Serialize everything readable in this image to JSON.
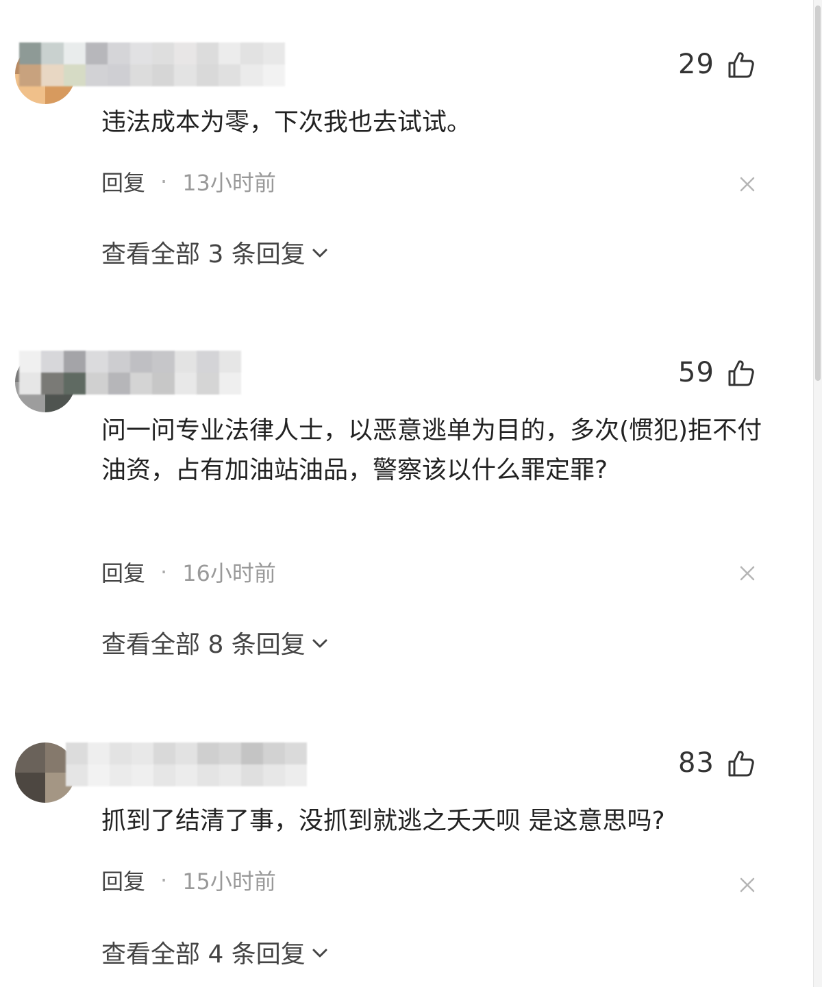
{
  "comments": [
    {
      "likes": "29",
      "text": "违法成本为零，下次我也去试试。",
      "reply_label": "回复",
      "separator": "·",
      "time": "13小时前",
      "view_replies": "查看全部 3 条回复",
      "avatar_colors": [
        "#b98a62",
        "#e3b27b",
        "#f0c08a",
        "#d79a5e"
      ],
      "name_blur_colors": [
        "#8e9a96",
        "#c9d1cf",
        "#e9ecec",
        "#b7b7bb",
        "#d5d5d8",
        "#e1e1e3",
        "#dedede",
        "#e8e6e6",
        "#dcdcdc",
        "#ececec",
        "#e2e2e2",
        "#e8e8e8",
        "#c8a27e",
        "#e8d7c3",
        "#d6dbc5",
        "#d2d2d5",
        "#cfcfd3",
        "#dcdcdc",
        "#d6d6d6",
        "#e3e3e3",
        "#d9d9d9",
        "#e0e0e0",
        "#ebebeb",
        "#f2f2f2"
      ]
    },
    {
      "likes": "59",
      "text": "问一问专业法律人士，以恶意逃单为目的，多次(惯犯)拒不付油资，占有加油站油品，警察该以什么罪定罪?",
      "reply_label": "回复",
      "separator": "·",
      "time": "16小时前",
      "view_replies": "查看全部 8 条回复",
      "avatar_colors": [
        "#7a7a7a",
        "#5d6460",
        "#9d9d9d",
        "#4f5450"
      ],
      "name_blur_colors": [
        "#f0f0f0",
        "#d7d7da",
        "#a4a4a8",
        "#dbdbdd",
        "#cdcdd0",
        "#bfbfc3",
        "#c6c6c9",
        "#e3e3e3",
        "#d4d4d7",
        "#e6e6e6",
        "#e6e6e6",
        "#7a7a76",
        "#5f6a62",
        "#d0d0d0",
        "#b6b6b9",
        "#d4d4d4",
        "#c7c7c7",
        "#e8e8e8",
        "#d5d5d5",
        "#efefef"
      ]
    },
    {
      "likes": "83",
      "text": "抓到了结清了事，没抓到就逃之夭夭呗 是这意思吗?",
      "reply_label": "回复",
      "separator": "·",
      "time": "15小时前",
      "view_replies": "查看全部 4 条回复",
      "avatar_colors": [
        "#6a625a",
        "#85796c",
        "#4d4741",
        "#a49684"
      ],
      "name_blur_colors": [
        "#dcdcdc",
        "#eeeeee",
        "#e3e3e3",
        "#e8e8e8",
        "#d9d9d9",
        "#e2e2e2",
        "#cfcfcf",
        "#d6d6d6",
        "#c4c4c4",
        "#d2d2d2",
        "#dadada",
        "#e5e5e5",
        "#f2f2f2",
        "#ebebeb",
        "#efefef",
        "#e6e6e6",
        "#ececec",
        "#e4e4e4",
        "#e9e9e9",
        "#dfdfdf",
        "#e7e7e7",
        "#ededed"
      ]
    }
  ],
  "colors": {
    "text": "#222222",
    "meta": "#999999",
    "link": "#444444",
    "icon": "#333333"
  },
  "icons": {
    "like": "thumbs-up-icon",
    "close": "close-icon",
    "expand": "chevron-down-icon"
  }
}
